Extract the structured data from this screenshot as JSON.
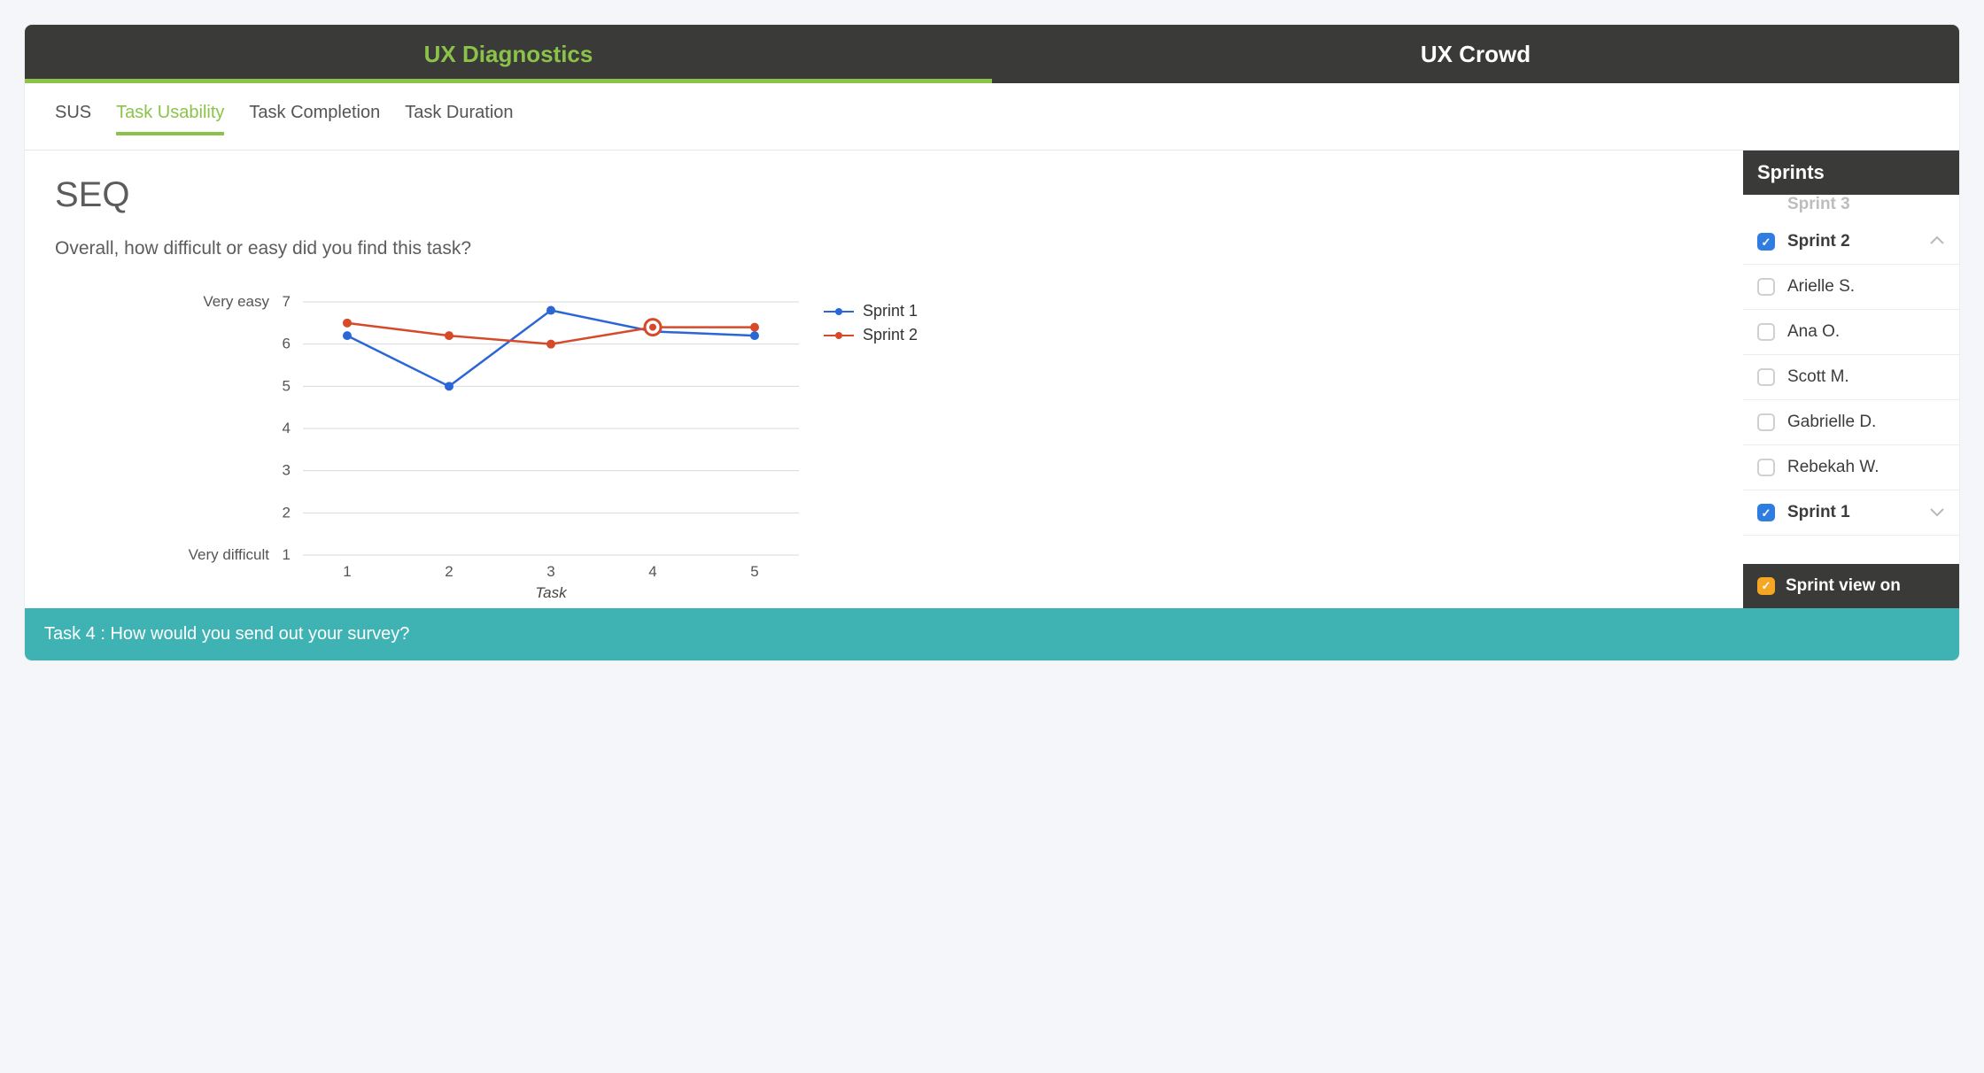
{
  "topTabs": {
    "diagnostics": "UX Diagnostics",
    "crowd": "UX Crowd"
  },
  "subTabs": {
    "sus": "SUS",
    "taskUsability": "Task Usability",
    "taskCompletion": "Task Completion",
    "taskDuration": "Task Duration"
  },
  "page": {
    "title": "SEQ",
    "question": "Overall, how difficult or easy did you find this task?"
  },
  "legend": {
    "sprint1": "Sprint 1",
    "sprint2": "Sprint 2"
  },
  "axis": {
    "topLabel": "Very easy",
    "bottomLabel": "Very difficult",
    "xlabel": "Task"
  },
  "sidebar": {
    "header": "Sprints",
    "sprint3": "Sprint 3",
    "sprint2": "Sprint 2",
    "participants": {
      "p0": "Arielle S.",
      "p1": "Ana O.",
      "p2": "Scott M.",
      "p3": "Gabrielle D.",
      "p4": "Rebekah W."
    },
    "sprint1": "Sprint 1",
    "sprintView": "Sprint view on"
  },
  "footer": {
    "text": "Task 4 : How would you send out your survey?"
  },
  "chart_data": {
    "type": "line",
    "title": "SEQ",
    "subtitle": "Overall, how difficult or easy did you find this task?",
    "xlabel": "Task",
    "ylabel": "",
    "y_top_anchor_label": "Very easy",
    "y_bottom_anchor_label": "Very difficult",
    "categories": [
      1,
      2,
      3,
      4,
      5
    ],
    "ylim": [
      1,
      7
    ],
    "y_ticks": [
      1,
      2,
      3,
      4,
      5,
      6,
      7
    ],
    "series": [
      {
        "name": "Sprint 1",
        "color": "#2a66d6",
        "values": [
          6.2,
          5.0,
          6.8,
          6.3,
          6.2
        ]
      },
      {
        "name": "Sprint 2",
        "color": "#d64a2a",
        "values": [
          6.5,
          6.2,
          6.0,
          6.4,
          6.4
        ]
      }
    ],
    "highlighted_point": {
      "series": "Sprint 2",
      "category": 4,
      "value": 6.4
    }
  }
}
